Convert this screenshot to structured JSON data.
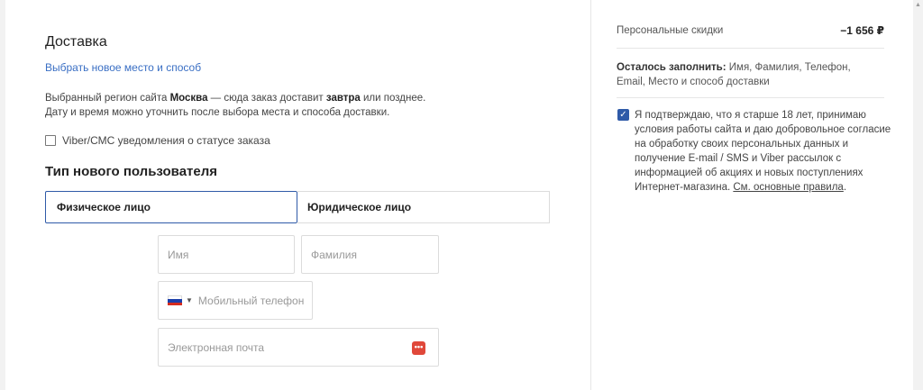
{
  "delivery": {
    "title": "Доставка",
    "choose_link": "Выбрать новое место и способ",
    "info_prefix": "Выбранный регион сайта ",
    "info_region": "Москва",
    "info_middle": " — сюда заказ доставит ",
    "info_when": "завтра",
    "info_suffix": " или позднее.",
    "info_line2": "Дату и время можно уточнить после выбора места и способа доставки.",
    "viber_label": "Viber/СМС уведомления о статусе заказа",
    "viber_checked": false
  },
  "user_type": {
    "title": "Тип нового пользователя",
    "tabs": [
      {
        "label": "Физическое лицо",
        "active": true
      },
      {
        "label": "Юридическое лицо",
        "active": false
      }
    ]
  },
  "form": {
    "name_placeholder": "Имя",
    "surname_placeholder": "Фамилия",
    "phone_placeholder": "Мобильный телефон",
    "email_placeholder": "Электронная почта",
    "phone_flag_colors": [
      "#ffffff",
      "#1c3faa",
      "#d52b1e"
    ]
  },
  "summary": {
    "discount_label": "Персональные скидки",
    "discount_value": "−1 656 ₽",
    "remain_label": "Осталось заполнить:",
    "remain_fields": "Имя, Фамилия, Телефон, Email, Место и способ доставки",
    "consent_text": "Я подтверждаю, что я старше 18 лет, принимаю условия работы сайта и даю добровольное согласие на обработку своих персональных данных и получение E-mail / SMS и Viber рассылок с информацией об акциях и новых поступлениях Интернет-магазина. ",
    "consent_link": "См. основные правила",
    "consent_end": ".",
    "consent_checked": true
  },
  "colors": {
    "accent": "#2f5aa8",
    "link": "#3a6fc4",
    "password_icon": "#e0483a"
  }
}
